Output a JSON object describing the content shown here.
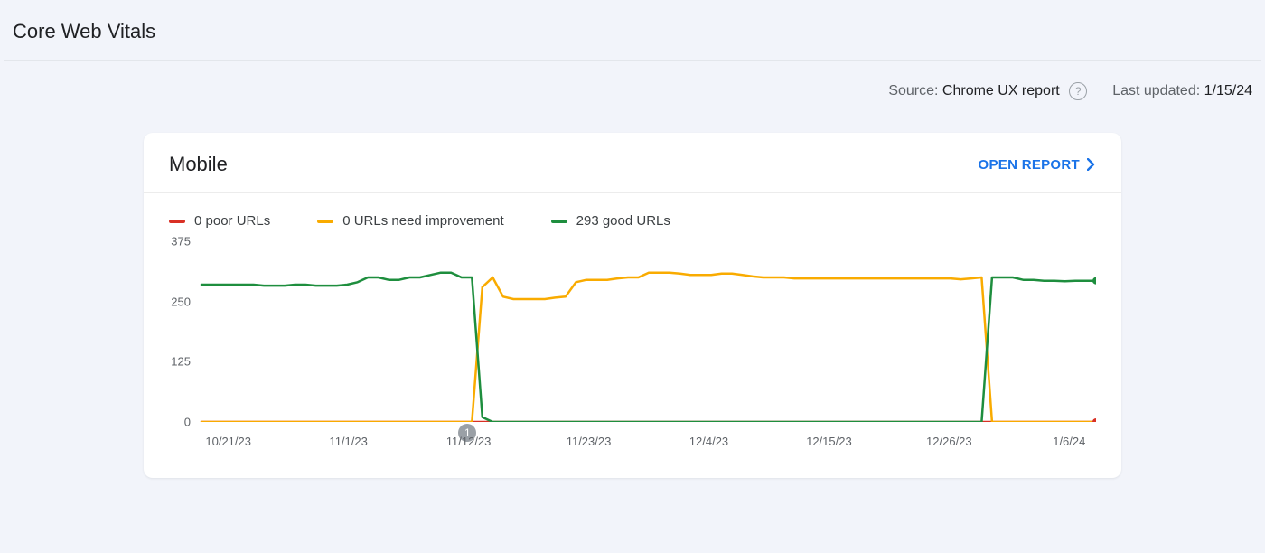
{
  "page_title": "Core Web Vitals",
  "meta": {
    "source_label": "Source:",
    "source_value": "Chrome UX report",
    "last_updated_label": "Last updated:",
    "last_updated_value": "1/15/24"
  },
  "card": {
    "title": "Mobile",
    "open_report_label": "OPEN REPORT"
  },
  "legend": {
    "poor": {
      "label": "0 poor URLs",
      "color": "#d93025"
    },
    "needs": {
      "label": "0 URLs need improvement",
      "color": "#f9ab00"
    },
    "good": {
      "label": "293 good URLs",
      "color": "#1e8e3e"
    }
  },
  "chart_data": {
    "type": "line",
    "xlabel": "",
    "ylabel": "",
    "ylim": [
      0,
      375
    ],
    "y_ticks": [
      0,
      125,
      250,
      375
    ],
    "x_tick_labels": [
      "10/21/23",
      "11/1/23",
      "11/12/23",
      "11/23/23",
      "12/4/23",
      "12/15/23",
      "12/26/23",
      "1/6/24"
    ],
    "x": [
      0,
      1,
      2,
      3,
      4,
      5,
      6,
      7,
      8,
      9,
      10,
      11,
      12,
      13,
      14,
      15,
      16,
      17,
      18,
      19,
      20,
      21,
      22,
      23,
      24,
      25,
      26,
      27,
      28,
      29,
      30,
      31,
      32,
      33,
      34,
      35,
      36,
      37,
      38,
      39,
      40,
      41,
      42,
      43,
      44,
      45,
      46,
      47,
      48,
      49,
      50,
      51,
      52,
      53,
      54,
      55,
      56,
      57,
      58,
      59,
      60,
      61,
      62,
      63,
      64,
      65,
      66,
      67,
      68,
      69,
      70,
      71,
      72,
      73,
      74,
      75,
      76,
      77,
      78,
      79,
      80,
      81,
      82,
      83,
      84,
      85,
      86
    ],
    "series": [
      {
        "name": "poor",
        "color": "#d93025",
        "values": [
          0,
          0,
          0,
          0,
          0,
          0,
          0,
          0,
          0,
          0,
          0,
          0,
          0,
          0,
          0,
          0,
          0,
          0,
          0,
          0,
          0,
          0,
          0,
          0,
          0,
          0,
          0,
          0,
          0,
          0,
          0,
          0,
          0,
          0,
          0,
          0,
          0,
          0,
          0,
          0,
          0,
          0,
          0,
          0,
          0,
          0,
          0,
          0,
          0,
          0,
          0,
          0,
          0,
          0,
          0,
          0,
          0,
          0,
          0,
          0,
          0,
          0,
          0,
          0,
          0,
          0,
          0,
          0,
          0,
          0,
          0,
          0,
          0,
          0,
          0,
          0,
          0,
          0,
          0,
          0,
          0,
          0,
          0,
          0,
          0,
          0,
          0
        ]
      },
      {
        "name": "needs_improvement",
        "color": "#f9ab00",
        "values": [
          0,
          0,
          0,
          0,
          0,
          0,
          0,
          0,
          0,
          0,
          0,
          0,
          0,
          0,
          0,
          0,
          0,
          0,
          0,
          0,
          0,
          0,
          0,
          0,
          0,
          0,
          0,
          280,
          300,
          260,
          255,
          255,
          255,
          255,
          258,
          260,
          290,
          295,
          295,
          295,
          298,
          300,
          300,
          310,
          310,
          310,
          308,
          305,
          305,
          305,
          308,
          308,
          305,
          302,
          300,
          300,
          300,
          298,
          298,
          298,
          298,
          298,
          298,
          298,
          298,
          298,
          298,
          298,
          298,
          298,
          298,
          298,
          298,
          296,
          298,
          300,
          0,
          0,
          0,
          0,
          0,
          0,
          0,
          0,
          0,
          0,
          0
        ]
      },
      {
        "name": "good",
        "color": "#1e8e3e",
        "values": [
          285,
          285,
          285,
          285,
          285,
          285,
          283,
          283,
          283,
          285,
          285,
          283,
          283,
          283,
          285,
          290,
          300,
          300,
          295,
          295,
          300,
          300,
          305,
          310,
          310,
          300,
          300,
          10,
          0,
          0,
          0,
          0,
          0,
          0,
          0,
          0,
          0,
          0,
          0,
          0,
          0,
          0,
          0,
          0,
          0,
          0,
          0,
          0,
          0,
          0,
          0,
          0,
          0,
          0,
          0,
          0,
          0,
          0,
          0,
          0,
          0,
          0,
          0,
          0,
          0,
          0,
          0,
          0,
          0,
          0,
          0,
          0,
          0,
          0,
          0,
          0,
          300,
          300,
          300,
          295,
          295,
          293,
          293,
          292,
          293,
          293,
          293
        ]
      }
    ],
    "event_marker": {
      "x_index": 28,
      "label": "1"
    },
    "end_dots": [
      {
        "series": "poor",
        "value": 0,
        "color": "#d93025"
      },
      {
        "series": "good",
        "value": 293,
        "color": "#1e8e3e"
      }
    ]
  }
}
